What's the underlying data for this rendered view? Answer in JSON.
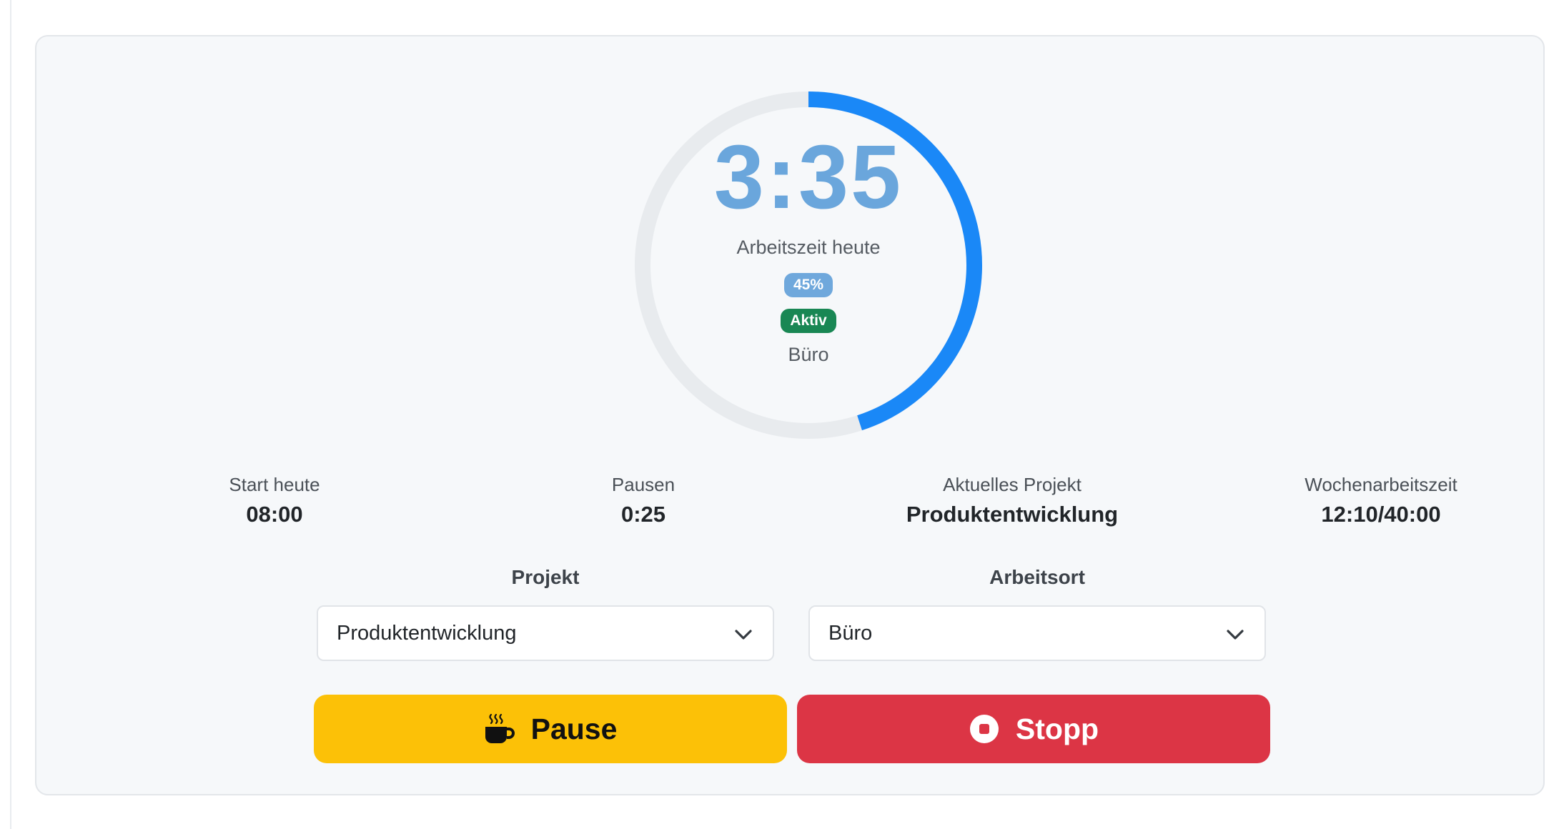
{
  "timer": {
    "time": "3:35",
    "label": "Arbeitszeit heute",
    "percent_label": "45%",
    "progress": 0.45,
    "status": "Aktiv",
    "location": "Büro"
  },
  "stats": [
    {
      "label": "Start heute",
      "value": "08:00"
    },
    {
      "label": "Pausen",
      "value": "0:25"
    },
    {
      "label": "Aktuelles Projekt",
      "value": "Produktentwicklung"
    },
    {
      "label": "Wochenarbeitszeit",
      "value": "12:10/40:00"
    }
  ],
  "form": {
    "project_label": "Projekt",
    "project_value": "Produktentwicklung",
    "location_label": "Arbeitsort",
    "location_value": "Büro"
  },
  "actions": {
    "pause_label": "Pause",
    "stop_label": "Stopp"
  },
  "colors": {
    "progress": "#1a88f7",
    "track": "#e8ebee",
    "pause": "#fcc107",
    "stop": "#dc3545",
    "active_badge": "#198754",
    "percent_badge": "#6fa8dc"
  },
  "icons": {
    "pause": "coffee-cup-icon",
    "stop": "stop-circle-icon",
    "dropdown": "chevron-down-icon"
  }
}
